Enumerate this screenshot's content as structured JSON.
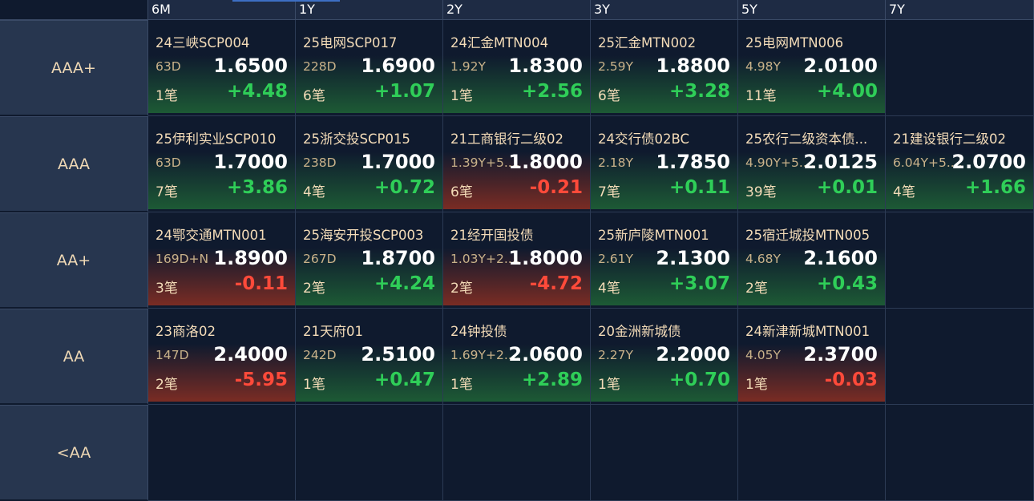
{
  "columns": [
    "6M",
    "1Y",
    "2Y",
    "3Y",
    "5Y",
    "7Y"
  ],
  "colors": {
    "up": "#2fce58",
    "down": "#ff4a3a",
    "label": "#f0d9b5"
  },
  "rows": [
    {
      "label": "AAA+",
      "cells": [
        {
          "name": "24三峡SCP004",
          "term": "63D",
          "rate": "1.6500",
          "count": "1笔",
          "change": "+4.48",
          "dir": "up"
        },
        {
          "name": "25电网SCP017",
          "term": "228D",
          "rate": "1.6900",
          "count": "6笔",
          "change": "+1.07",
          "dir": "up"
        },
        {
          "name": "24汇金MTN004",
          "term": "1.92Y",
          "rate": "1.8300",
          "count": "1笔",
          "change": "+2.56",
          "dir": "up"
        },
        {
          "name": "25汇金MTN002",
          "term": "2.59Y",
          "rate": "1.8800",
          "count": "6笔",
          "change": "+3.28",
          "dir": "up"
        },
        {
          "name": "25电网MTN006",
          "term": "4.98Y",
          "rate": "2.0100",
          "count": "11笔",
          "change": "+4.00",
          "dir": "up"
        },
        null
      ]
    },
    {
      "label": "AAA",
      "cells": [
        {
          "name": "25伊利实业SCP010",
          "term": "63D",
          "rate": "1.7000",
          "count": "7笔",
          "change": "+3.86",
          "dir": "up"
        },
        {
          "name": "25浙交投SCP015",
          "term": "238D",
          "rate": "1.7000",
          "count": "4笔",
          "change": "+0.72",
          "dir": "up"
        },
        {
          "name": "21工商银行二级02",
          "term": "1.39Y+5....",
          "rate": "1.8000",
          "count": "6笔",
          "change": "-0.21",
          "dir": "down"
        },
        {
          "name": "24交行债02BC",
          "term": "2.18Y",
          "rate": "1.7850",
          "count": "7笔",
          "change": "+0.11",
          "dir": "up"
        },
        {
          "name": "25农行二级资本债...",
          "term": "4.90Y+5....",
          "rate": "2.0125",
          "count": "39笔",
          "change": "+0.01",
          "dir": "up"
        },
        {
          "name": "21建设银行二级02",
          "term": "6.04Y+5....",
          "rate": "2.0700",
          "count": "4笔",
          "change": "+1.66",
          "dir": "up"
        }
      ]
    },
    {
      "label": "AA+",
      "cells": [
        {
          "name": "24鄂交通MTN001",
          "term": "169D+N",
          "rate": "1.8900",
          "count": "3笔",
          "change": "-0.11",
          "dir": "down"
        },
        {
          "name": "25海安开投SCP003",
          "term": "267D",
          "rate": "1.8700",
          "count": "2笔",
          "change": "+4.24",
          "dir": "up"
        },
        {
          "name": "21经开国投债",
          "term": "1.03Y+2....",
          "rate": "1.8000",
          "count": "2笔",
          "change": "-4.72",
          "dir": "down"
        },
        {
          "name": "25新庐陵MTN001",
          "term": "2.61Y",
          "rate": "2.1300",
          "count": "4笔",
          "change": "+3.07",
          "dir": "up"
        },
        {
          "name": "25宿迁城投MTN005",
          "term": "4.68Y",
          "rate": "2.1600",
          "count": "2笔",
          "change": "+0.43",
          "dir": "up"
        },
        null
      ]
    },
    {
      "label": "AA",
      "cells": [
        {
          "name": "23商洛02",
          "term": "147D",
          "rate": "2.4000",
          "count": "2笔",
          "change": "-5.95",
          "dir": "down"
        },
        {
          "name": "21天府01",
          "term": "242D",
          "rate": "2.5100",
          "count": "1笔",
          "change": "+0.47",
          "dir": "up"
        },
        {
          "name": "24钟投债",
          "term": "1.69Y+2....",
          "rate": "2.0600",
          "count": "1笔",
          "change": "+2.89",
          "dir": "up"
        },
        {
          "name": "20金洲新城债",
          "term": "2.27Y",
          "rate": "2.2000",
          "count": "1笔",
          "change": "+0.70",
          "dir": "up"
        },
        {
          "name": "24新津新城MTN001",
          "term": "4.05Y",
          "rate": "2.3700",
          "count": "1笔",
          "change": "-0.03",
          "dir": "down"
        },
        null
      ]
    },
    {
      "label": "<AA",
      "cells": [
        null,
        null,
        null,
        null,
        null,
        null
      ]
    }
  ]
}
